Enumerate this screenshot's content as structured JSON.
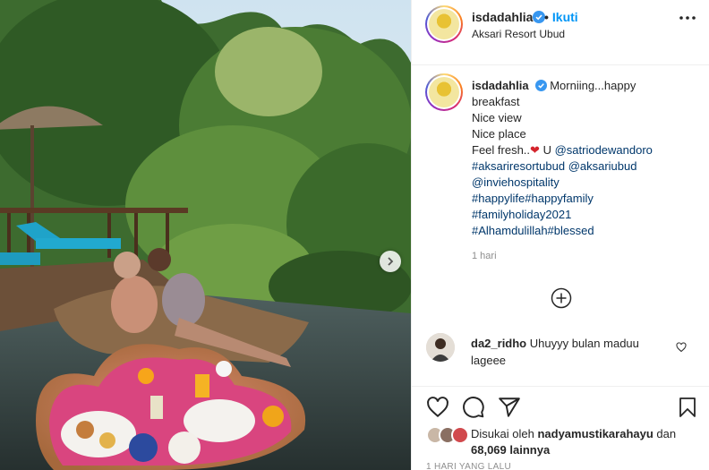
{
  "post": {
    "username": "isdadahlia",
    "follow_label": "Ikuti",
    "separator": "•",
    "location": "Aksari Resort Ubud",
    "caption_lines": [
      "Morniing...happy",
      "breakfast",
      "Nice view",
      "Nice place",
      "Feel fresh..",
      "U",
      "@satriodewandoro",
      "#aksariresortubud",
      "@aksariubud",
      "@inviehospitality",
      "#happylife#happyfamily",
      "#familyholiday2021",
      "#Alhamdulillah#blessed"
    ],
    "heart_emoji": "❤",
    "time_ago": "1 hari"
  },
  "comment": {
    "username": "da2_ridho",
    "text": "Uhuyyy bulan maduu lageee"
  },
  "likes": {
    "prefix": "Disukai oleh",
    "user": "nadyamustikarahayu",
    "and": "dan",
    "count": "68,069",
    "suffix": "lainnya"
  },
  "footer_faded": "1 HARI YANG LALU",
  "icons": {
    "verified": "verified-badge-icon",
    "more": "more-options-icon",
    "next": "chevron-right-icon",
    "load_more": "plus-circle-icon",
    "like": "heart-icon",
    "comment": "comment-icon",
    "share": "share-icon",
    "save": "bookmark-icon"
  },
  "colors": {
    "link": "#0095f6",
    "verified": "#3897f0",
    "tag": "#00376b",
    "muted": "#8e8e8e"
  }
}
